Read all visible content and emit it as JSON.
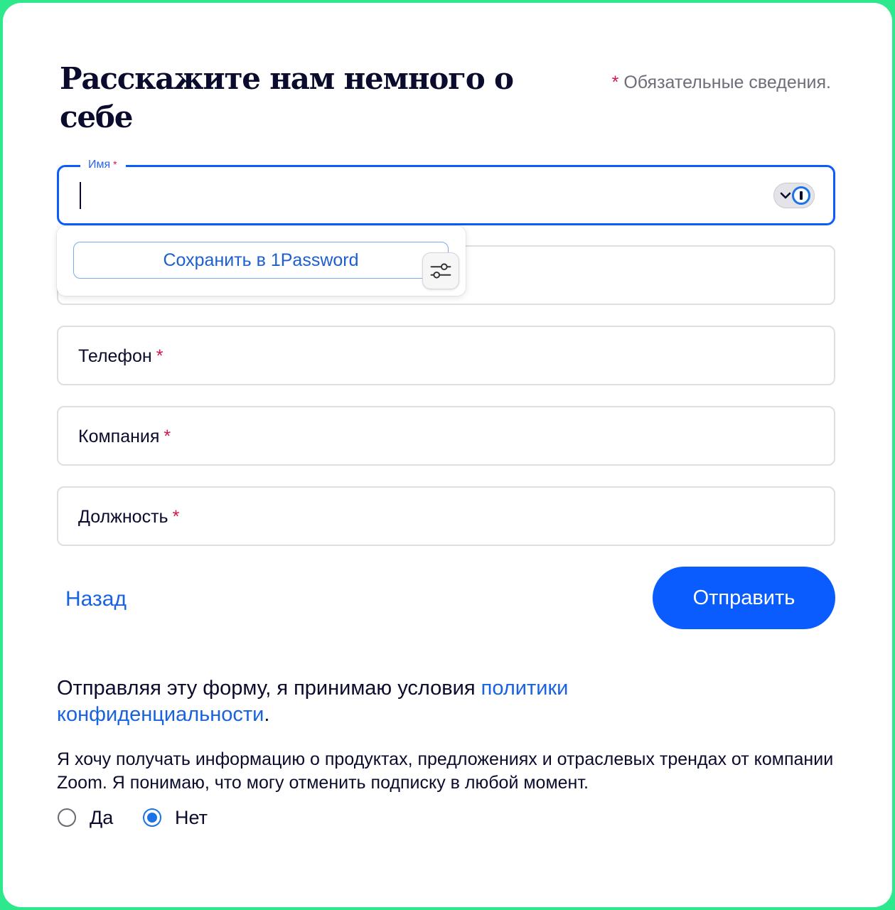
{
  "form": {
    "title": "Расскажите нам немного о себе",
    "required_mark": "*",
    "required_note": "Обязательные сведения."
  },
  "fields": {
    "name": {
      "label": "Имя",
      "value": ""
    },
    "phone": {
      "label": "Телефон"
    },
    "company": {
      "label": "Компания"
    },
    "job_title": {
      "label": "Должность"
    }
  },
  "password_manager": {
    "save_label": "Сохранить в 1Password",
    "badge_icon": "1password-icon",
    "settings_icon": "sliders-icon"
  },
  "actions": {
    "back_label": "Назад",
    "submit_label": "Отправить"
  },
  "consent": {
    "prefix": "Отправляя эту форму, я принимаю условия ",
    "link_text": "политики конфиденциальности",
    "suffix": "."
  },
  "marketing": {
    "text": "Я хочу получать информацию о продуктах, предложениях и отраслевых трендах от компании Zoom. Я понимаю, что могу отменить подписку в любой момент.",
    "options": [
      {
        "label": "Да",
        "selected": false
      },
      {
        "label": "Нет",
        "selected": true
      }
    ]
  },
  "colors": {
    "accent": "#0b5cff",
    "link": "#1a63e0",
    "required": "#d3164a",
    "frame": "#2ee88e"
  }
}
